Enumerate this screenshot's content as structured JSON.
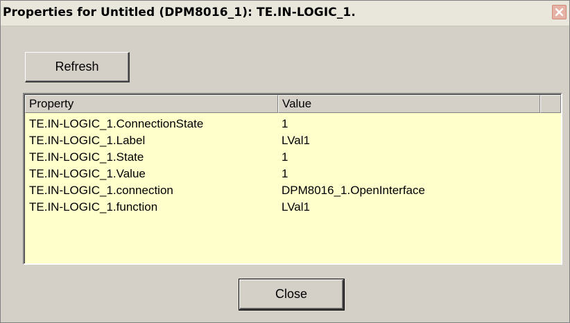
{
  "window": {
    "title": "Properties for Untitled (DPM8016_1): TE.IN-LOGIC_1."
  },
  "toolbar": {
    "refresh_label": "Refresh"
  },
  "table": {
    "columns": [
      "Property",
      "Value"
    ],
    "rows": [
      {
        "property": "TE.IN-LOGIC_1.ConnectionState",
        "value": "1"
      },
      {
        "property": "TE.IN-LOGIC_1.Label",
        "value": "LVal1"
      },
      {
        "property": "TE.IN-LOGIC_1.State",
        "value": "1"
      },
      {
        "property": "TE.IN-LOGIC_1.Value",
        "value": "1"
      },
      {
        "property": "TE.IN-LOGIC_1.connection",
        "value": "DPM8016_1.OpenInterface"
      },
      {
        "property": "TE.IN-LOGIC_1.function",
        "value": "LVal1"
      }
    ]
  },
  "footer": {
    "close_label": "Close"
  },
  "colors": {
    "list_background": "#ffffcc",
    "dialog_background": "#d4d0c8",
    "close_icon_background": "#e6b2a6"
  },
  "icons": {
    "close": "close-icon"
  }
}
